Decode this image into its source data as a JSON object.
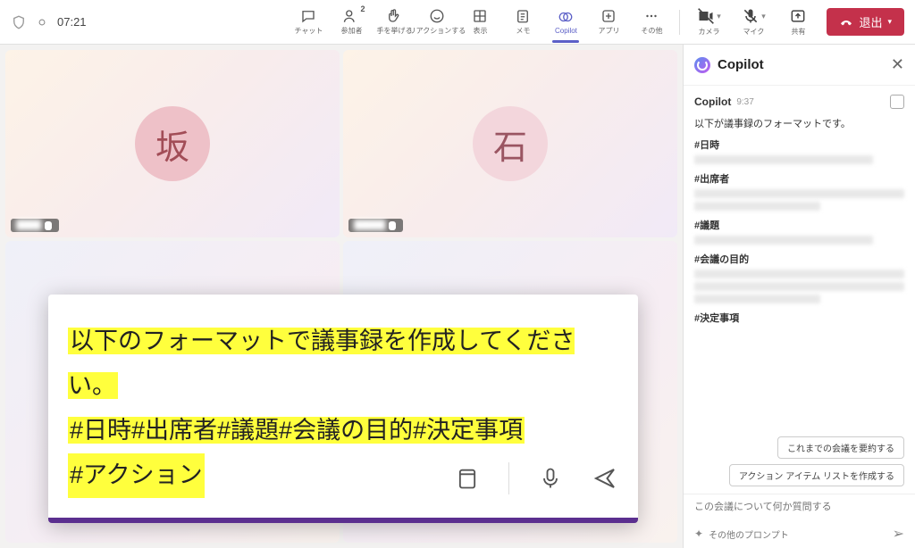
{
  "header": {
    "timer": "07:21",
    "tools": [
      {
        "key": "chat",
        "label": "チャット"
      },
      {
        "key": "participants",
        "label": "参加者",
        "badge": "2"
      },
      {
        "key": "raisehand",
        "label": "手を挙げる"
      },
      {
        "key": "react",
        "label": "リアクションする"
      },
      {
        "key": "view",
        "label": "表示"
      },
      {
        "key": "notes",
        "label": "メモ"
      },
      {
        "key": "copilot",
        "label": "Copilot",
        "active": true
      },
      {
        "key": "apps",
        "label": "アプリ"
      },
      {
        "key": "more",
        "label": "その他"
      }
    ],
    "controls": {
      "camera": "カメラ",
      "mic": "マイク",
      "share": "共有"
    },
    "leave": "退出"
  },
  "tiles": [
    {
      "initial": "坂"
    },
    {
      "initial": "石"
    }
  ],
  "prompt": {
    "line1": "以下のフォーマットで議事録を作成してください。",
    "line2": "#日時#出席者#議題#会議の目的#決定事項",
    "line3": "#アクション"
  },
  "copilot": {
    "title": "Copilot",
    "message": {
      "sender": "Copilot",
      "time": "9:37",
      "intro": "以下が議事録のフォーマットです。",
      "sections": [
        "#日時",
        "#出席者",
        "#議題",
        "#会議の目的",
        "#決定事項"
      ]
    },
    "suggestions": [
      "これまでの会議を要約する",
      "アクション アイテム リストを作成する"
    ],
    "input_placeholder": "この会議について何か質問する",
    "more_prompts": "その他のプロンプト"
  }
}
